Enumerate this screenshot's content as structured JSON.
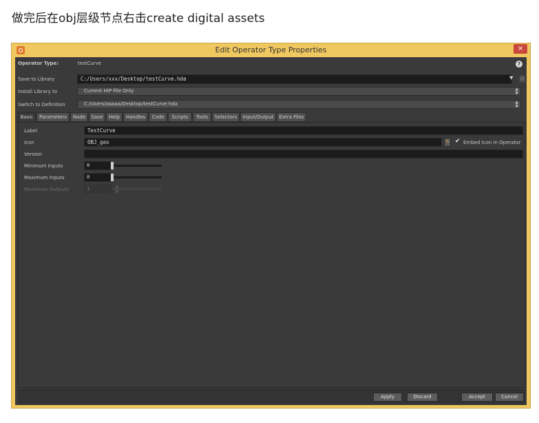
{
  "caption": "做完后在obj层级节点右击create digital assets",
  "window": {
    "title": "Edit Operator Type Properties",
    "close_label": "×"
  },
  "header": {
    "operator_type_label": "Operator Type:",
    "operator_type_value": "testCurve",
    "help_label": "?",
    "save_to_library_label": "Save to Library",
    "save_to_library_value": "C:/Users/xxx/Desktop/testCurve.hda",
    "install_library_label": "Install Library to",
    "install_library_value": "Current HIP File Only",
    "switch_definition_label": "Switch to Definition",
    "switch_definition_value": "C:/Users/aaaaa/Desktop/testCurve.hda"
  },
  "tabs": [
    "Basic",
    "Parameters",
    "Node",
    "Save",
    "Help",
    "Handles",
    "Code",
    "Scripts",
    "Tools",
    "Selectors",
    "Input/Output",
    "Extra Files"
  ],
  "basic": {
    "label_label": "Label",
    "label_value": "TestCurve",
    "icon_label": "Icon",
    "icon_value": "OBJ_geo",
    "embed_icon_label": "Embed Icon in Operator",
    "version_label": "Version",
    "version_value": "",
    "min_inputs_label": "Minimum Inputs",
    "min_inputs_value": "0",
    "max_inputs_label": "Maximum Inputs",
    "max_inputs_value": "0",
    "max_outputs_label": "Maximum Outputs",
    "max_outputs_value": "1"
  },
  "buttons": {
    "apply": "Apply",
    "discard": "Discard",
    "accept": "Accept",
    "cancel": "Cancel"
  },
  "colors": {
    "frame": "#f0c860",
    "panel": "#3a3a3a",
    "field": "#1b1b1b"
  }
}
